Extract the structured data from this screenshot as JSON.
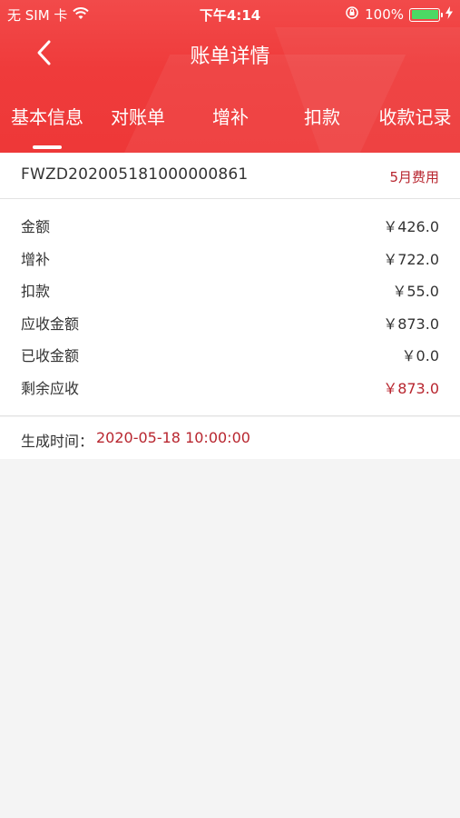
{
  "status_bar": {
    "carrier": "无 SIM 卡",
    "time": "下午4:14",
    "battery_percent": "100%",
    "battery_level": 1.0
  },
  "nav": {
    "title": "账单详情",
    "back_icon": "chevron-left-icon"
  },
  "tabs": [
    {
      "label": "基本信息",
      "active": true
    },
    {
      "label": "对账单",
      "active": false
    },
    {
      "label": "增补",
      "active": false
    },
    {
      "label": "扣款",
      "active": false
    },
    {
      "label": "收款记录",
      "active": false
    }
  ],
  "bill": {
    "number": "FWZD202005181000000861",
    "tag": "5月费用"
  },
  "amounts": [
    {
      "label": "金额",
      "value": "￥426.0",
      "highlight": false
    },
    {
      "label": "增补",
      "value": "￥722.0",
      "highlight": false
    },
    {
      "label": "扣款",
      "value": "￥55.0",
      "highlight": false
    },
    {
      "label": "应收金额",
      "value": "￥873.0",
      "highlight": false
    },
    {
      "label": "已收金额",
      "value": "￥0.0",
      "highlight": false
    },
    {
      "label": "剩余应收",
      "value": "￥873.0",
      "highlight": true
    }
  ],
  "generated": {
    "label": "生成时间：",
    "value": "2020-05-18 10:00:00"
  },
  "colors": {
    "header_red": "#ee3838",
    "accent_red": "#b8262f",
    "background": "#f4f4f4",
    "battery_green": "#4cd964"
  }
}
